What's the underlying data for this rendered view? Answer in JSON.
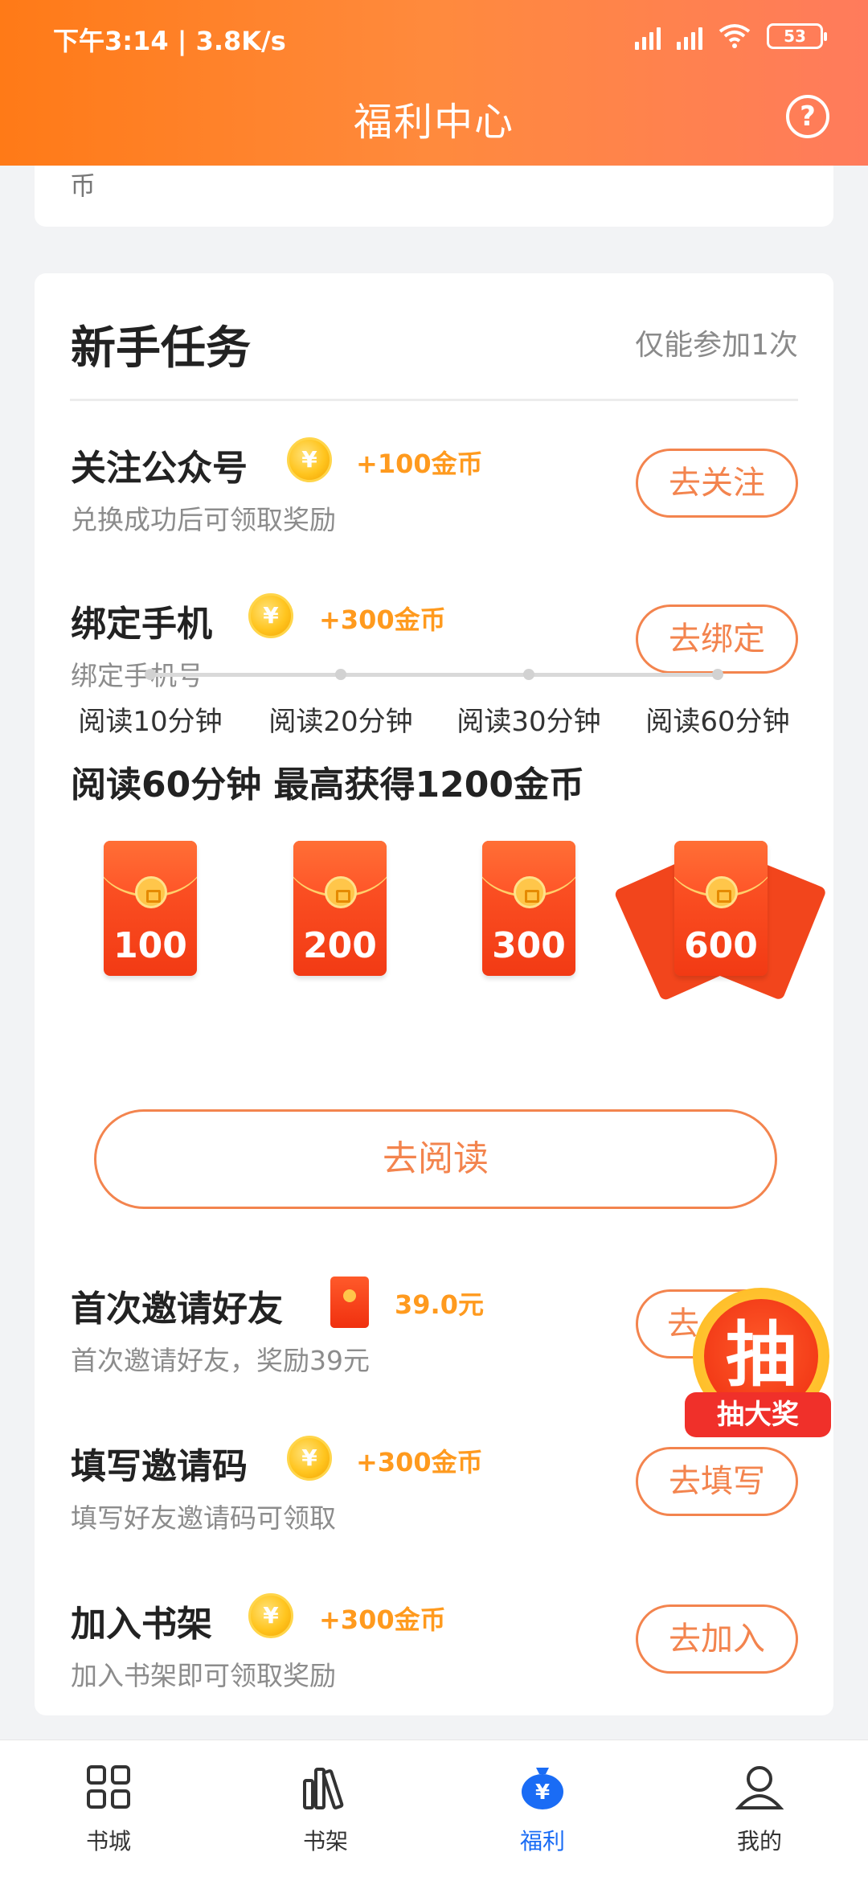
{
  "status_bar": {
    "time": "下午3:14 | 3.8K/s",
    "battery": "53"
  },
  "header": {
    "title": "福利中心",
    "help": "?"
  },
  "top_card": {
    "text": "币"
  },
  "section": {
    "title": "新手任务",
    "note": "仅能参加1次"
  },
  "tasks": [
    {
      "title": "关注公众号",
      "reward": "+100金币",
      "desc": "兑换成功后可领取奖励",
      "button": "去关注"
    },
    {
      "title": "绑定手机",
      "reward": "+300金币",
      "desc": "绑定手机号",
      "button": "去绑定"
    }
  ],
  "reading": {
    "title": "阅读60分钟 最高获得1200金币",
    "envelopes": [
      "100",
      "200",
      "300",
      "600"
    ],
    "steps": [
      "阅读10分钟",
      "阅读20分钟",
      "阅读30分钟",
      "阅读60分钟"
    ],
    "button": "去阅读"
  },
  "tasks2": [
    {
      "title": "首次邀请好友",
      "reward": "39.0元",
      "desc": "首次邀请好友，奖励39元",
      "button": "去"
    },
    {
      "title": "填写邀请码",
      "reward": "+300金币",
      "desc": "填写好友邀请码可领取",
      "button": "去填写"
    },
    {
      "title": "加入书架",
      "reward": "+300金币",
      "desc": "加入书架即可领取奖励",
      "button": "去加入"
    }
  ],
  "coin_symbol": "¥",
  "lottery": {
    "char": "抽",
    "label": "抽大奖"
  },
  "bottom_nav": [
    {
      "label": "书城",
      "icon": "grid-icon"
    },
    {
      "label": "书架",
      "icon": "books-icon"
    },
    {
      "label": "福利",
      "icon": "money-bag-icon"
    },
    {
      "label": "我的",
      "icon": "user-icon"
    }
  ],
  "colors": {
    "accent": "#f3844e",
    "header_start": "#ff7a17",
    "header_end": "#ff7b5c",
    "active_nav": "#1a6cf5",
    "reward": "#ff9a1e"
  }
}
